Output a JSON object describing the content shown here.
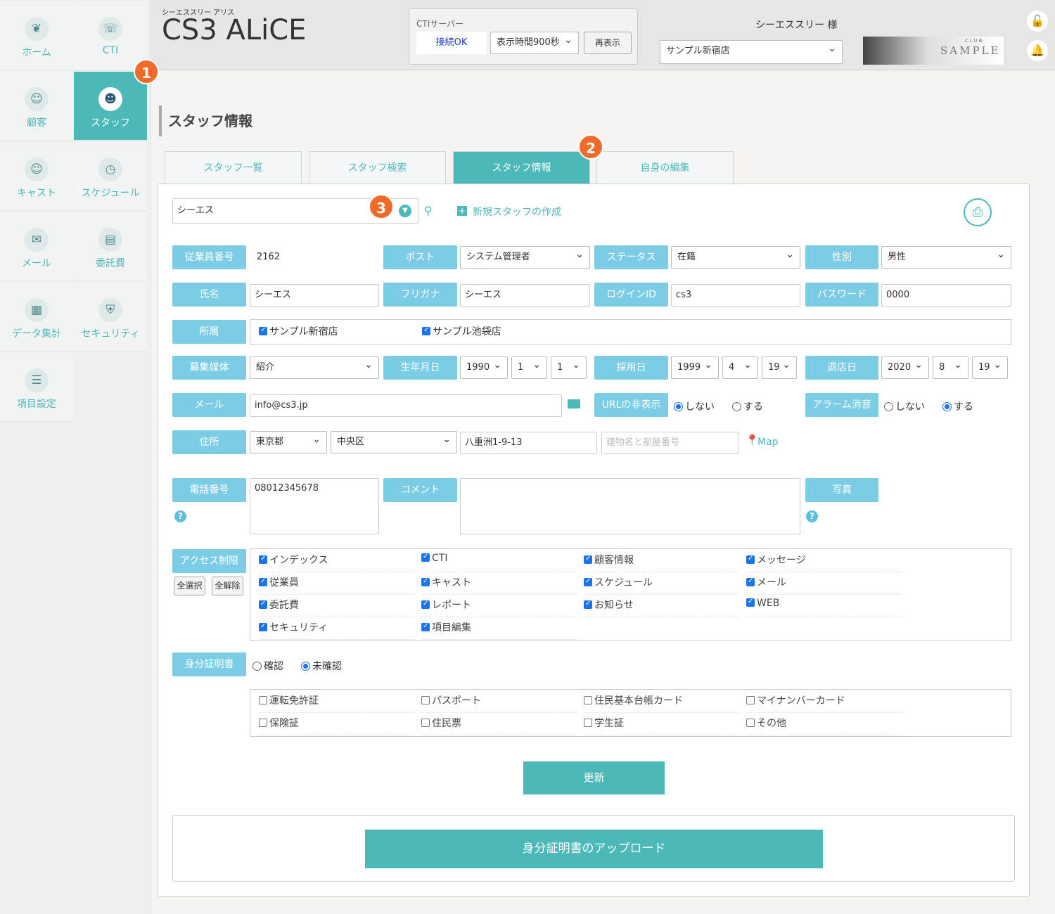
{
  "app": {
    "subtitle": "シーエススリー アリス",
    "title": "CS3 ALiCE",
    "user": "シーエススリー 様",
    "store_select": "サンプル新宿店",
    "banner": {
      "small": "CLUB",
      "big": "SAMPLE"
    }
  },
  "cti": {
    "label": "CTIサーバー",
    "status": "接続OK",
    "display_time": "表示時間900秒",
    "redisplay": "再表示"
  },
  "sidebar": [
    {
      "label": "ホーム",
      "icon": "rabbit-icon"
    },
    {
      "label": "CTI",
      "icon": "phone-icon"
    },
    {
      "label": "顧客",
      "icon": "customer-icon"
    },
    {
      "label": "スタッフ",
      "icon": "staff-icon"
    },
    {
      "label": "キャスト",
      "icon": "cast-icon"
    },
    {
      "label": "スケジュール",
      "icon": "clock-icon"
    },
    {
      "label": "メール",
      "icon": "mail-icon"
    },
    {
      "label": "委託費",
      "icon": "wallet-icon"
    },
    {
      "label": "データ集計",
      "icon": "chart-icon"
    },
    {
      "label": "セキュリティ",
      "icon": "shield-icon"
    },
    {
      "label": "項目設定",
      "icon": "clipboard-icon"
    }
  ],
  "badges": [
    "1",
    "2",
    "3"
  ],
  "page": {
    "title": "スタッフ情報"
  },
  "tabs": [
    "スタッフ一覧",
    "スタッフ検索",
    "スタッフ情報",
    "自身の編集"
  ],
  "search": {
    "value": "シーエス",
    "new_staff": "新規スタッフの作成"
  },
  "form": {
    "emp_no_label": "従業員番号",
    "emp_no": "2162",
    "post_label": "ポスト",
    "post": "システム管理者",
    "status_label": "ステータス",
    "status": "在籍",
    "gender_label": "性別",
    "gender": "男性",
    "name_label": "氏名",
    "name": "シーエス",
    "kana_label": "フリガナ",
    "kana": "シーエス",
    "login_label": "ログインID",
    "login": "cs3",
    "password_label": "パスワード",
    "password": "0000",
    "affil_label": "所属",
    "affil": [
      "サンプル新宿店",
      "サンプル池袋店"
    ],
    "media_label": "募集媒体",
    "media": "紹介",
    "birth_label": "生年月日",
    "birth": [
      "1990",
      "1",
      "1"
    ],
    "hire_label": "採用日",
    "hire": [
      "1999",
      "4",
      "19"
    ],
    "leave_label": "退店日",
    "leave": [
      "2020",
      "8",
      "19"
    ],
    "mail_label": "メール",
    "mail": "info@cs3.jp",
    "url_label": "URLの非表示",
    "no": "しない",
    "yes": "する",
    "alarm_label": "アラーム消音",
    "addr_label": "住所",
    "pref": "東京都",
    "city": "中央区",
    "street": "八重洲1-9-13",
    "building_ph": "建物名と部屋番号",
    "map": "Map",
    "tel_label": "電話番号",
    "tel": "08012345678",
    "comment_label": "コメント",
    "photo_label": "写真",
    "access_label": "アクセス制限",
    "select_all": "全選択",
    "clear_all": "全解除",
    "access": [
      "インデックス",
      "CTI",
      "顧客情報",
      "メッセージ",
      "従業員",
      "キャスト",
      "スケジュール",
      "メール",
      "委託費",
      "レポート",
      "お知らせ",
      "WEB",
      "セキュリティ",
      "項目編集"
    ],
    "id_label": "身分証明書",
    "confirmed": "確認",
    "unconfirmed": "未確認",
    "id_types": [
      "運転免許証",
      "パスポート",
      "住民基本台帳カード",
      "マイナンバーカード",
      "保険証",
      "住民票",
      "学生証",
      "その他"
    ],
    "update": "更新",
    "upload": "身分証明書のアップロード"
  }
}
